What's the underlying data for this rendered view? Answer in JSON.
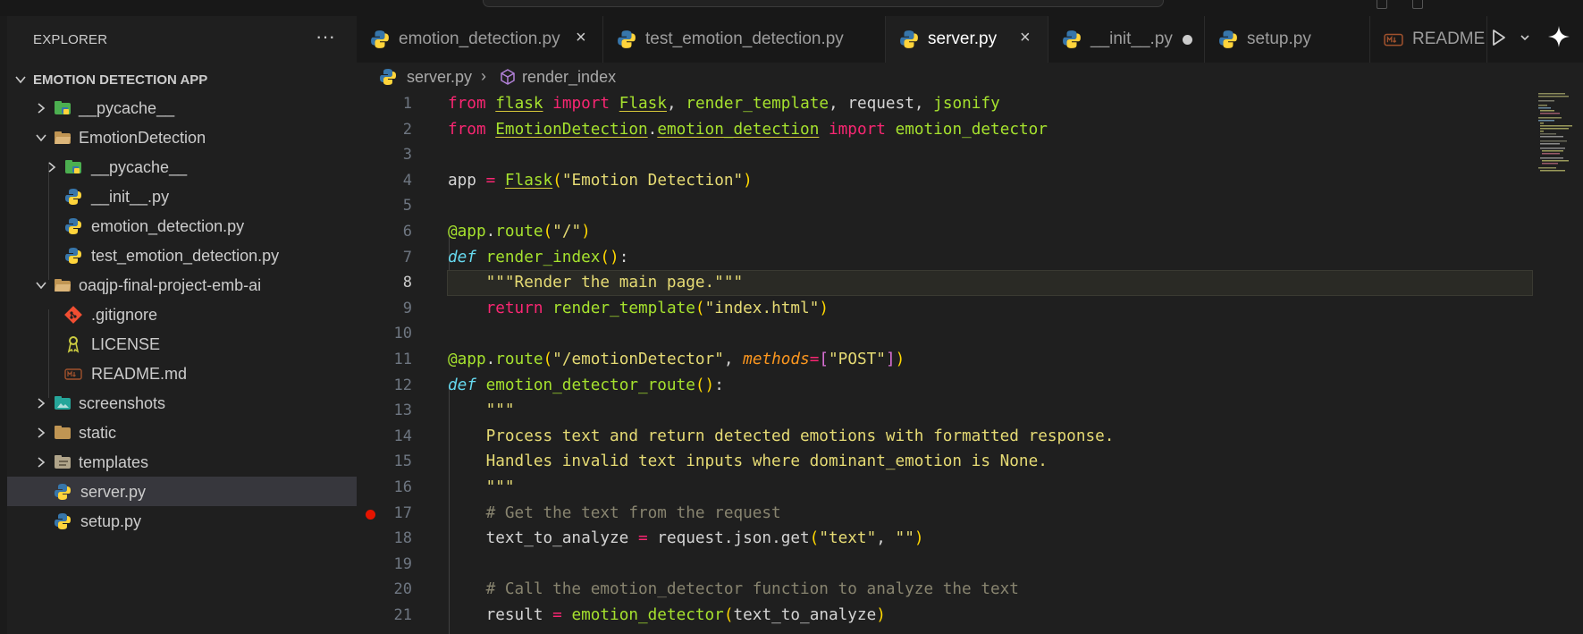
{
  "explorer": {
    "title": "EXPLORER",
    "more": "···",
    "root": "EMOTION DETECTION APP",
    "items": [
      {
        "label": "__pycache__",
        "icon": "python-folder-icon"
      },
      {
        "label": "EmotionDetection",
        "icon": "folder-open-icon"
      },
      {
        "label": "__pycache__",
        "icon": "python-folder-icon"
      },
      {
        "label": "__init__.py",
        "icon": "python-file-icon"
      },
      {
        "label": "emotion_detection.py",
        "icon": "python-file-icon"
      },
      {
        "label": "test_emotion_detection.py",
        "icon": "python-file-icon"
      },
      {
        "label": "oaqjp-final-project-emb-ai",
        "icon": "folder-open-icon"
      },
      {
        "label": ".gitignore",
        "icon": "git-icon"
      },
      {
        "label": "LICENSE",
        "icon": "license-icon"
      },
      {
        "label": "README.md",
        "icon": "markdown-icon"
      },
      {
        "label": "screenshots",
        "icon": "images-folder-icon"
      },
      {
        "label": "static",
        "icon": "folder-icon"
      },
      {
        "label": "templates",
        "icon": "templates-folder-icon"
      },
      {
        "label": "server.py",
        "icon": "python-file-icon"
      },
      {
        "label": "setup.py",
        "icon": "python-file-icon"
      }
    ]
  },
  "tabs": [
    {
      "label": "emotion_detection.py",
      "close": "×"
    },
    {
      "label": "test_emotion_detection.py"
    },
    {
      "label": "server.py",
      "close": "×"
    },
    {
      "label": "__init__.py"
    },
    {
      "label": "setup.py"
    },
    {
      "label": "README.md"
    }
  ],
  "breadcrumb": {
    "file": "server.py",
    "sep": "›",
    "symbol": "render_index"
  },
  "colors": {
    "accent_selected": "#37373d",
    "breakpoint": "#e51400"
  },
  "editor": {
    "current_line": 8,
    "breakpoint_line": 17,
    "line_numbers": [
      "1",
      "2",
      "3",
      "4",
      "5",
      "6",
      "7",
      "8",
      "9",
      "10",
      "11",
      "12",
      "13",
      "14",
      "15",
      "16",
      "17",
      "18",
      "19",
      "20",
      "21"
    ],
    "lines": [
      "from flask import Flask, render_template, request, jsonify",
      "from EmotionDetection.emotion_detection import emotion_detector",
      "",
      "app = Flask(\"Emotion Detection\")",
      "",
      "@app.route(\"/\")",
      "def render_index():",
      "    \"\"\"Render the main page.\"\"\"",
      "    return render_template(\"index.html\")",
      "",
      "@app.route(\"/emotionDetector\", methods=[\"POST\"])",
      "def emotion_detector_route():",
      "    \"\"\"",
      "    Process text and return detected emotions with formatted response.",
      "    Handles invalid text inputs where dominant_emotion is None.",
      "    \"\"\"",
      "    # Get the text from the request",
      "    text_to_analyze = request.json.get(\"text\", \"\")",
      "",
      "    # Call the emotion_detector function to analyze the text",
      "    result = emotion_detector(text_to_analyze)"
    ]
  }
}
